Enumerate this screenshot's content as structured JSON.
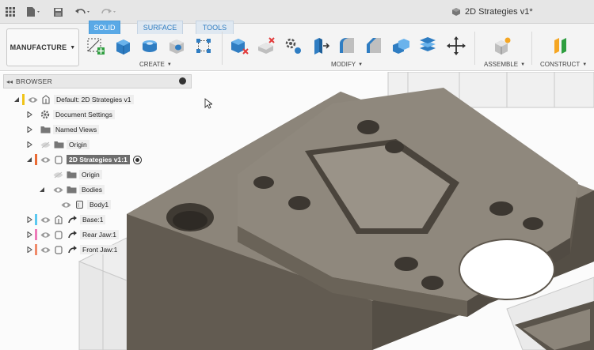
{
  "document": {
    "title": "2D Strategies v1*"
  },
  "workspace": {
    "label": "MANUFACTURE"
  },
  "tabs": [
    {
      "label": "SOLID",
      "active": true
    },
    {
      "label": "SURFACE",
      "active": false
    },
    {
      "label": "TOOLS",
      "active": false
    }
  ],
  "groups": {
    "create": "CREATE",
    "modify": "MODIFY",
    "assemble": "ASSEMBLE",
    "construct": "CONSTRUCT"
  },
  "browser": {
    "title": "BROWSER",
    "items": [
      {
        "label": "Default: 2D Strategies v1"
      },
      {
        "label": "Document Settings"
      },
      {
        "label": "Named Views"
      },
      {
        "label": "Origin"
      },
      {
        "label": "2D Strategies v1:1"
      },
      {
        "label": "Origin"
      },
      {
        "label": "Bodies"
      },
      {
        "label": "Body1"
      },
      {
        "label": "Base:1"
      },
      {
        "label": "Rear Jaw:1"
      },
      {
        "label": "Front Jaw:1"
      }
    ]
  },
  "colors": {
    "accent": "#5aa9e6",
    "part_top": "#8c857a",
    "part_side": "#6e675d",
    "base_bar": "#f0c419",
    "instance_bar": "#ea6b35",
    "base1_bar": "#5bc8f0",
    "rear_jaw_bar": "#ee7ab8",
    "front_jaw_bar": "#f08a6a"
  }
}
